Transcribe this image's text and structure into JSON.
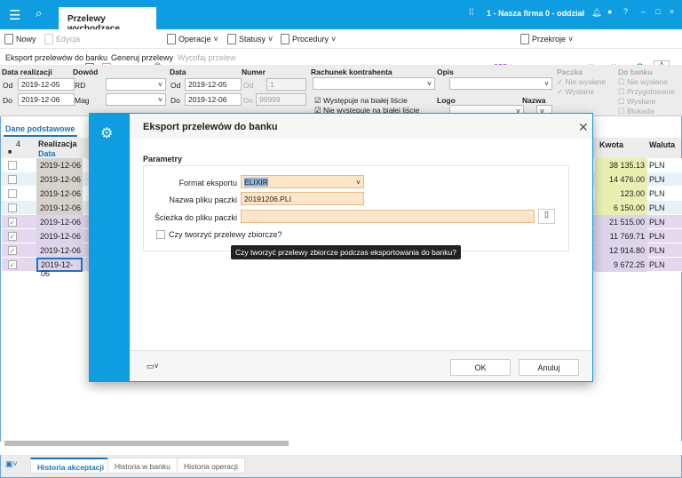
{
  "titlebar": {
    "tab": "Przelewy wychodzące",
    "company": "1 - Nasza firma 0 - oddział"
  },
  "toolbar": {
    "new": "Nowy",
    "edit": "Edycja",
    "operations": "Operacje",
    "statuses": "Statusy",
    "procedures": "Procedury",
    "views": "Przekroje"
  },
  "actions": {
    "export": "Eksport przelewów do banku",
    "generate": "Generuj przelewy",
    "withdraw": "Wycofaj przelew"
  },
  "filters": {
    "data_realizacji": "Data realizacji",
    "od": "Od",
    "do": "Do",
    "real_od": "2019-12-05",
    "real_do": "2019-12-06",
    "dowod": "Dowód",
    "rd": "RD",
    "mag": "Mag",
    "data": "Data",
    "data_od": "2019-12-05",
    "data_do": "2019-12-06",
    "numer": "Numer",
    "num_od": "1",
    "num_do": "99999",
    "rachunek": "Rachunek kontrahenta",
    "biala1": "Występuje na białej liście",
    "biala2": "Nie występuje na białej liście",
    "opis": "Opis",
    "logo": "Logo",
    "nazwa": "Nazwa",
    "paczka": "Paczka",
    "paczka_items": [
      "Nie wysłane",
      "Wysłane"
    ],
    "do_banku": "Do banku",
    "do_banku_items": [
      "Nie wysłane",
      "Przygotowane",
      "Wysłane",
      "Blokada"
    ]
  },
  "grid": {
    "tab": "Dane podstawowe",
    "count": "4",
    "col_realizacja": "Realizacja",
    "col_data": "Data",
    "col_kwota": "Kwota",
    "col_waluta": "Waluta",
    "rows": [
      {
        "checked": false,
        "date": "2019-12-06",
        "kwota": "38 135.13",
        "waluta": "PLN"
      },
      {
        "checked": false,
        "date": "2019-12-06",
        "kwota": "14 476.00",
        "waluta": "PLN"
      },
      {
        "checked": false,
        "date": "2019-12-06",
        "kwota": "123.00",
        "waluta": "PLN"
      },
      {
        "checked": false,
        "date": "2019-12-06",
        "kwota": "6 150.00",
        "waluta": "PLN"
      },
      {
        "checked": true,
        "date": "2019-12-06",
        "kwota": "21 515.00",
        "waluta": "PLN"
      },
      {
        "checked": true,
        "date": "2019-12-06",
        "kwota": "11 769.71",
        "waluta": "PLN"
      },
      {
        "checked": true,
        "date": "2019-12-06",
        "kwota": "12 914.80",
        "waluta": "PLN"
      },
      {
        "checked": true,
        "date": "2019-12-06",
        "kwota": "9 672.25",
        "waluta": "PLN"
      }
    ]
  },
  "dialog": {
    "title": "Eksport przelewów do banku",
    "section": "Parametry",
    "format_label": "Format eksportu",
    "format_value": "ELIXIR",
    "filename_label": "Nazwa pliku paczki",
    "filename_value": "20191206.PLI",
    "path_label": "Ścieżka do pliku paczki",
    "path_value": "",
    "collective_label": "Czy tworzyć przelewy zbiorcze?",
    "tooltip": "Czy tworzyć przelewy zbiorcze podczas eksportowania do banku?",
    "ok": "OK",
    "cancel": "Anuluj"
  },
  "bottom_tabs": [
    "Historia akceptacji",
    "Historia w banku",
    "Historia operacji"
  ],
  "colors": {
    "accent": "#0e9de1",
    "selected_row": "#e3d8ee",
    "amount_bg": "#e8efb0",
    "field_bg": "#fde5c7"
  }
}
